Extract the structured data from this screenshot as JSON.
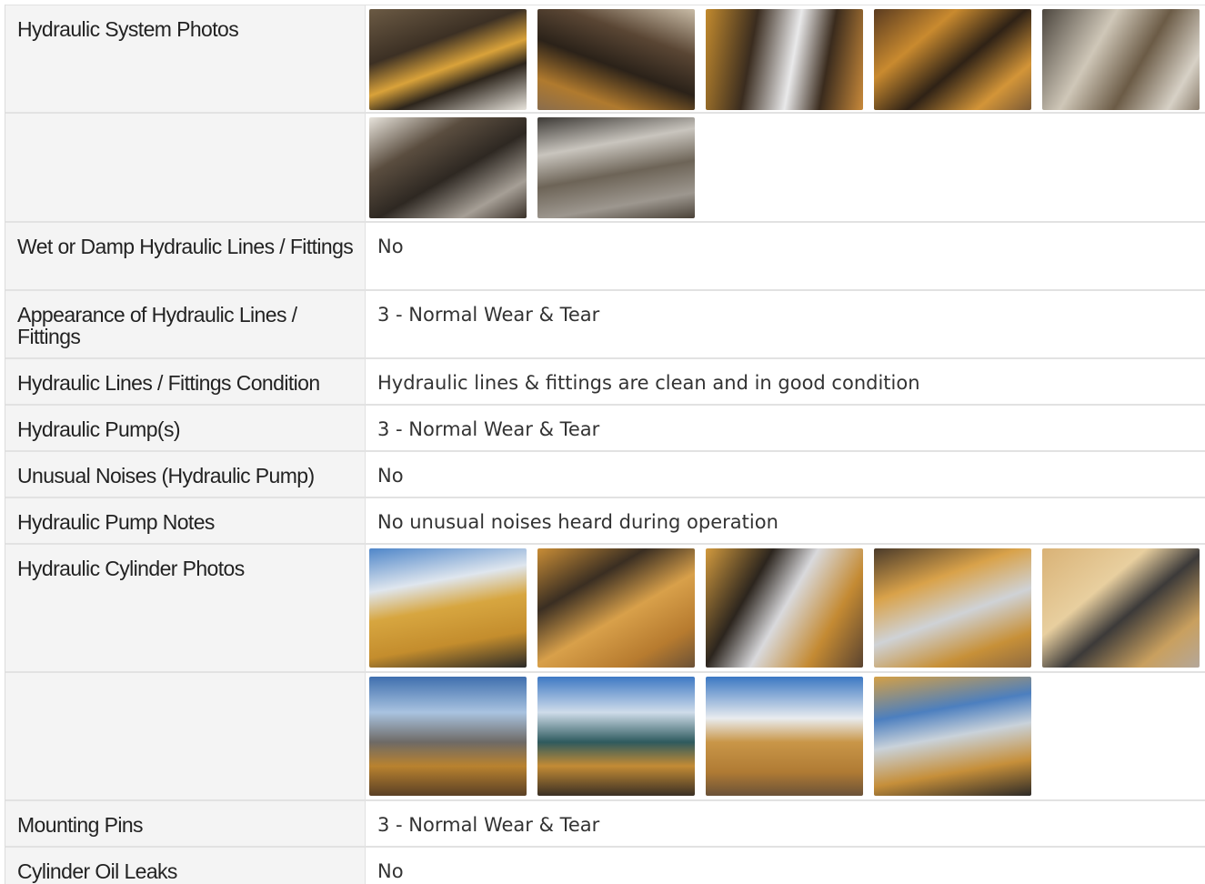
{
  "rows": [
    {
      "label": "Hydraulic System Photos",
      "type": "photos",
      "row_class": "r-photo1",
      "photos": [
        {
          "name": "hydraulic-system-photo-1",
          "bg": "linear-gradient(160deg,#6b5a44 0%,#3c3024 35%,#d9a23a 55%,#2d251c 70%,#e8e4dc 100%)"
        },
        {
          "name": "hydraulic-system-photo-2",
          "bg": "linear-gradient(200deg,#c8bba6 0%,#5a4634 30%,#2b2219 55%,#b07a2e 80%,#8a6d4d 100%)"
        },
        {
          "name": "hydraulic-system-photo-3",
          "bg": "linear-gradient(100deg,#c28a2e 0%,#3a2c1f 30%,#e9e9ea 55%,#3a2b1d 75%,#c8893a 100%)"
        },
        {
          "name": "hydraulic-system-photo-4",
          "bg": "linear-gradient(140deg,#5a3b20 0%,#c98a2f 30%,#2f2216 55%,#d39538 80%,#7b5a36 100%)"
        },
        {
          "name": "hydraulic-system-photo-5",
          "bg": "linear-gradient(120deg,#4c463e 0%,#cfc7b8 35%,#6b5b46 60%,#d7d1c6 85%,#8b7e6d 100%)"
        }
      ]
    },
    {
      "label": "",
      "type": "photos",
      "row_class": "r-photo2",
      "photos": [
        {
          "name": "hydraulic-system-photo-6",
          "bg": "linear-gradient(150deg,#e7e3db 0%,#5a4d3f 30%,#2e2822 55%,#a69f96 80%,#3a3129 100%)"
        },
        {
          "name": "hydraulic-system-photo-7",
          "bg": "linear-gradient(170deg,#3d3a36 0%,#c9c5be 30%,#6d6457 55%,#9d978f 80%,#4a4238 100%)"
        }
      ]
    },
    {
      "label": "Wet or Damp Hydraulic Lines / Fittings",
      "type": "text",
      "row_class": "r-2line",
      "value": "No"
    },
    {
      "label": "Appearance of Hydraulic Lines / Fittings",
      "type": "text",
      "row_class": "r-2line",
      "value": "3 - Normal Wear & Tear"
    },
    {
      "label": "Hydraulic Lines / Fittings Condition",
      "type": "text",
      "row_class": "r-1line",
      "value": "Hydraulic lines & fittings are clean and in good condition"
    },
    {
      "label": "Hydraulic Pump(s)",
      "type": "text",
      "row_class": "r-1line",
      "value": "3 - Normal Wear & Tear"
    },
    {
      "label": "Unusual Noises (Hydraulic Pump)",
      "type": "text",
      "row_class": "r-1line",
      "value": "No"
    },
    {
      "label": "Hydraulic Pump Notes",
      "type": "text",
      "row_class": "r-1line",
      "value": "No unusual noises heard during operation"
    },
    {
      "label": "Hydraulic Cylinder Photos",
      "type": "photos",
      "row_class": "r-cyl1",
      "photos": [
        {
          "name": "hydraulic-cylinder-photo-1",
          "bg": "linear-gradient(170deg,#4f86c9 0%,#dfe6ee 30%,#d7a640 50%,#c48d2d 75%,#2b2a28 100%)"
        },
        {
          "name": "hydraulic-cylinder-photo-2",
          "bg": "linear-gradient(150deg,#c98d36 0%,#3a2e22 30%,#d8a04a 55%,#b77b2f 80%,#6b5136 100%)"
        },
        {
          "name": "hydraulic-cylinder-photo-3",
          "bg": "linear-gradient(120deg,#d29a3e 0%,#2c251e 30%,#d9d9dc 50%,#c48a33 75%,#5a4330 100%)"
        },
        {
          "name": "hydraulic-cylinder-photo-4",
          "bg": "linear-gradient(160deg,#4a3a2a 0%,#d9a24a 30%,#cfd2d6 55%,#c79038 80%,#8e6a40 100%)"
        },
        {
          "name": "hydraulic-cylinder-photo-5",
          "bg": "linear-gradient(140deg,#d9b276 0%,#e8cf9f 35%,#3c3a39 55%,#c9a05f 80%,#b4a79a 100%)"
        }
      ]
    },
    {
      "label": "",
      "type": "photos",
      "row_class": "r-cyl2",
      "photos": [
        {
          "name": "hydraulic-cylinder-photo-6",
          "bg": "linear-gradient(180deg,#3f6fae 0%,#a9c3e0 30%,#6e6a66 55%,#b9822f 75%,#5a4025 100%)"
        },
        {
          "name": "hydraulic-cylinder-photo-7",
          "bg": "linear-gradient(180deg,#3e79c4 0%,#cfdcea 30%,#2e5a5e 55%,#c38b35 75%,#3a2f24 100%)"
        },
        {
          "name": "hydraulic-cylinder-photo-8",
          "bg": "linear-gradient(180deg,#3b78c3 0%,#e9ecef 35%,#c99648 55%,#b07b34 80%,#6b5238 100%)"
        },
        {
          "name": "hydraulic-cylinder-photo-9",
          "bg": "linear-gradient(170deg,#d4a046 0%,#4c7fbf 30%,#c9d2da 50%,#c68f3a 75%,#2d2a27 100%)"
        }
      ]
    },
    {
      "label": "Mounting Pins",
      "type": "text",
      "row_class": "r-1line",
      "value": "3 - Normal Wear & Tear"
    },
    {
      "label": "Cylinder Oil Leaks",
      "type": "text",
      "row_class": "r-1line",
      "value": "No"
    }
  ]
}
